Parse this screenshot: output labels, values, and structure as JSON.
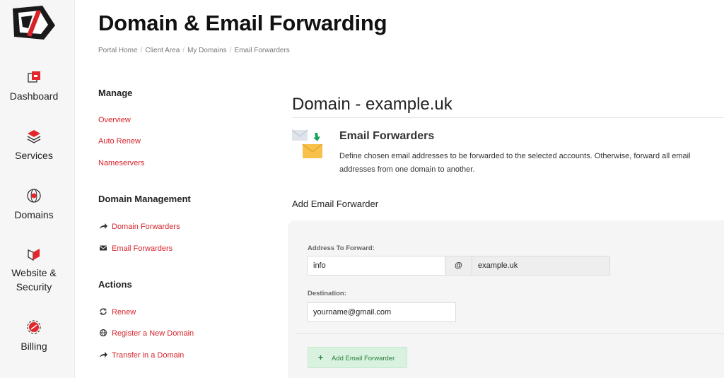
{
  "rail": {
    "items": [
      {
        "label": "Dashboard",
        "icon": "dashboard-icon"
      },
      {
        "label": "Services",
        "icon": "services-icon"
      },
      {
        "label": "Domains",
        "icon": "domains-icon"
      },
      {
        "label": "Website &",
        "label2": "Security",
        "icon": "security-icon"
      },
      {
        "label": "Billing",
        "icon": "billing-icon"
      }
    ]
  },
  "header": {
    "title": "Domain & Email Forwarding",
    "breadcrumb": [
      "Portal Home",
      "Client Area",
      "My Domains",
      "Email Forwarders"
    ]
  },
  "side": {
    "manage_title": "Manage",
    "manage_links": [
      "Overview",
      "Auto Renew",
      "Nameservers"
    ],
    "dm_title": "Domain Management",
    "dm_links": [
      "Domain Forwarders",
      "Email Forwarders"
    ],
    "actions_title": "Actions",
    "action_links": [
      "Renew",
      "Register a New Domain",
      "Transfer in a Domain"
    ]
  },
  "main": {
    "domain_title": "Domain - example.uk",
    "ef_title": "Email Forwarders",
    "ef_desc": "Define chosen email addresses to be forwarded to the selected accounts. Otherwise, forward all email addresses from one domain to another.",
    "add_heading": "Add Email Forwarder",
    "form": {
      "address_label": "Address To Forward:",
      "address_value": "info",
      "at": "@",
      "domain": "example.uk",
      "destination_label": "Destination:",
      "destination_value": "yourname@gmail.com",
      "button_label": "Add Email Forwarder",
      "button_plus": "+"
    }
  },
  "colors": {
    "accent": "#d6232a",
    "button_bg": "#d9f2df",
    "button_text": "#2a7d3c"
  }
}
